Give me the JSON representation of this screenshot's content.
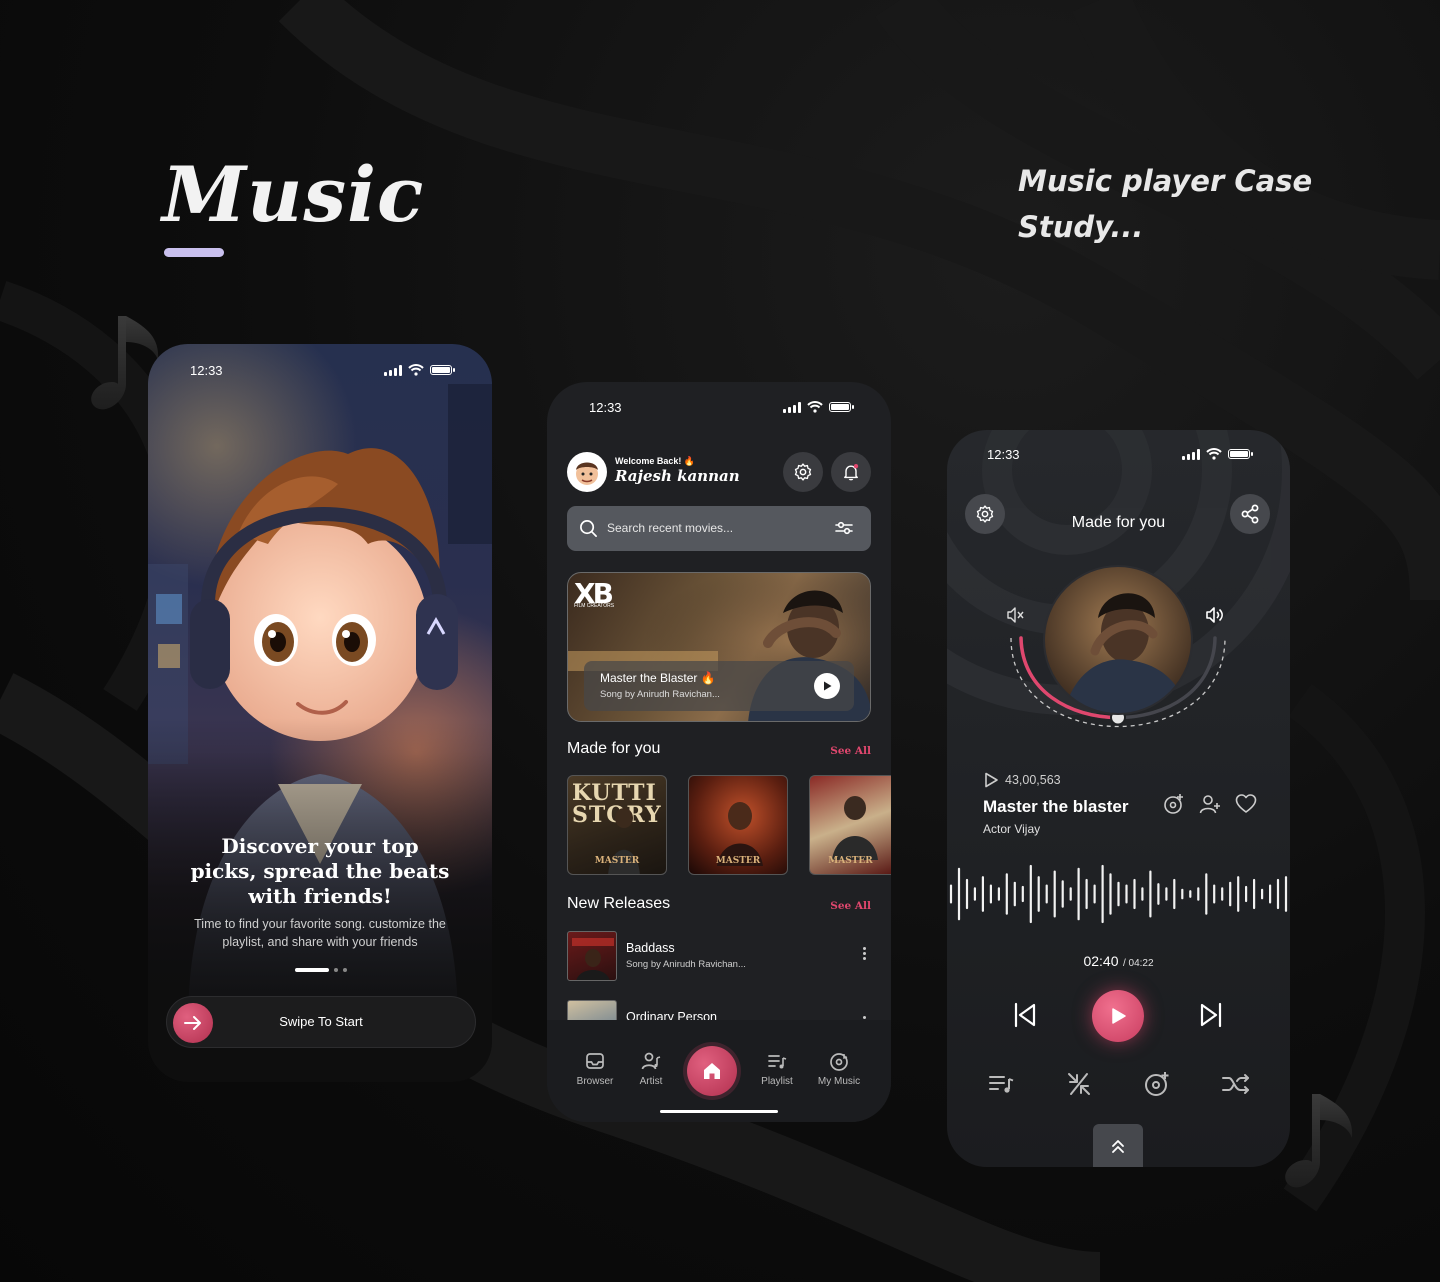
{
  "header": {
    "brand": "Music",
    "case_study_line1": "Music player Case",
    "case_study_line2": "Study..."
  },
  "colors": {
    "accent": "#e0476e",
    "underline": "#c9c0ee",
    "background": "#0d0d0d"
  },
  "onboarding": {
    "status_time": "12:33",
    "heading": "Discover your top picks, spread the beats with friends!",
    "subtext": "Time to find your favorite song. customize the playlist, and share with your friends",
    "swipe_label": "Swipe To Start",
    "page_count": 3,
    "active_page": 1
  },
  "home": {
    "status_time": "12:33",
    "welcome": "Welcome Back! 🔥",
    "username": "Rajesh kannan",
    "search_placeholder": "Search recent movies...",
    "hero": {
      "logo": "XB",
      "logo_sub": "FILM CREATORS",
      "title": "Master the Blaster 🔥",
      "subtitle": "Song by Anirudh Ravichan..."
    },
    "made_for_you": {
      "title": "Made for you",
      "see_all": "See All",
      "tiles": [
        {
          "art_text": "KUTTI STORY",
          "brand": "MASTER"
        },
        {
          "art_text": "",
          "brand": "MASTER"
        },
        {
          "art_text": "",
          "brand": "MASTER"
        }
      ]
    },
    "new_releases": {
      "title": "New Releases",
      "see_all": "See All",
      "items": [
        {
          "title": "Baddass",
          "subtitle": "Song by Anirudh Ravichan..."
        },
        {
          "title": "Ordinary Person",
          "subtitle": ""
        }
      ]
    },
    "nav": {
      "browser": "Browser",
      "artist": "Artist",
      "playlist": "Playlist",
      "my_music": "My Music"
    }
  },
  "player": {
    "status_time": "12:33",
    "header": "Made for you",
    "plays": "43,00,563",
    "song_title": "Master the blaster",
    "artist": "Actor Vijay",
    "current_time": "02:40",
    "total_time": "/ 04:22",
    "progress": 0.61
  }
}
